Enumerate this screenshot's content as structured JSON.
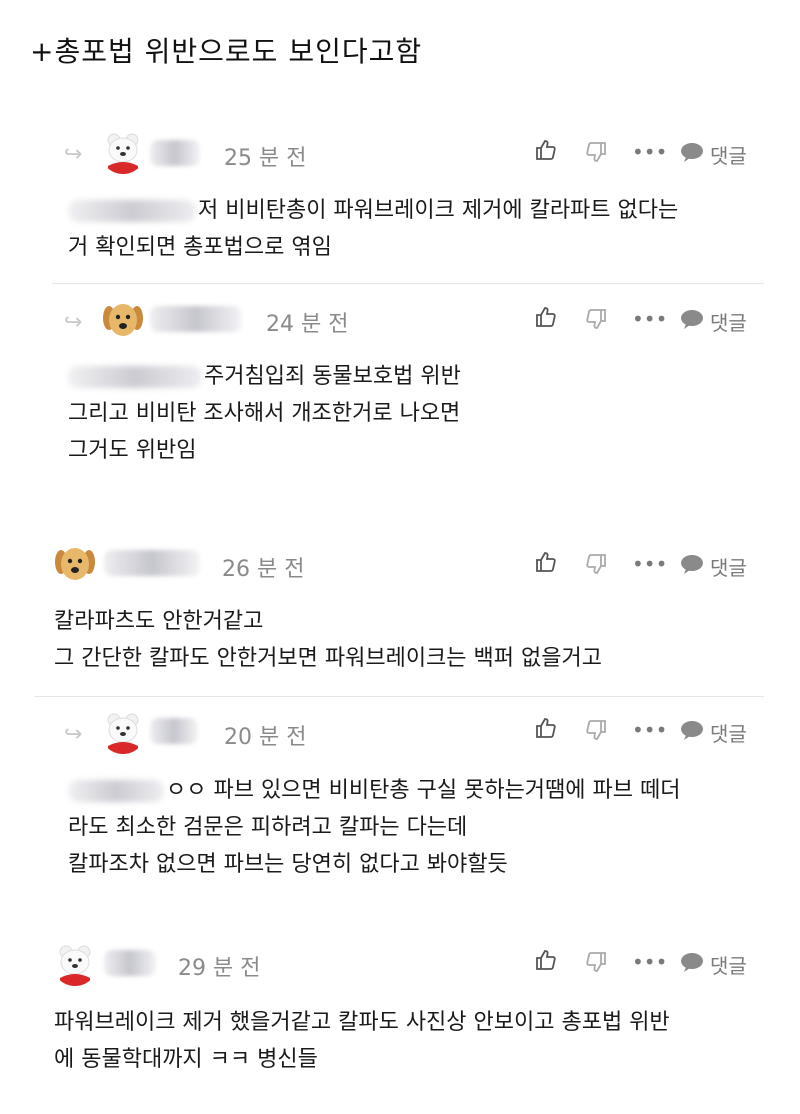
{
  "post_title": "+총포법 위반으로도 보인다고함",
  "actions": {
    "more": "•••",
    "reply": "댓글"
  },
  "colors": {
    "muted": "#8a8a8a",
    "divider": "#e6e6e6"
  },
  "comments": [
    {
      "avatar": "polar-bear",
      "is_reply": true,
      "time": "25 분 전",
      "lines": [
        "저 비비탄총이 파워브레이크 제거에 칼라파트 없다는",
        "거 확인되면 총포법으로 엮임"
      ]
    },
    {
      "avatar": "puppy",
      "is_reply": true,
      "time": "24 분 전",
      "lines": [
        "주거침입죄 동물보호법 위반",
        "그리고 비비탄 조사해서 개조한거로 나오면",
        "그거도 위반임"
      ]
    },
    {
      "avatar": "puppy",
      "is_reply": false,
      "time": "26 분 전",
      "lines": [
        "칼라파츠도 안한거같고",
        "그 간단한 칼파도 안한거보면 파워브레이크는 백퍼 없을거고"
      ]
    },
    {
      "avatar": "polar-bear",
      "is_reply": true,
      "time": "20 분 전",
      "lines": [
        "ㅇㅇ 파브 있으면 비비탄총 구실 못하는거땜에 파브 떼더",
        "라도 최소한 검문은 피하려고 칼파는 다는데",
        "칼파조차 없으면 파브는 당연히 없다고 봐야할듯"
      ]
    },
    {
      "avatar": "polar-bear",
      "is_reply": false,
      "time": "29 분 전",
      "lines": [
        "파워브레이크 제거 했을거같고 칼파도 사진상 안보이고 총포법 위반",
        "에 동물학대까지 ㅋㅋ 병신들"
      ]
    }
  ]
}
